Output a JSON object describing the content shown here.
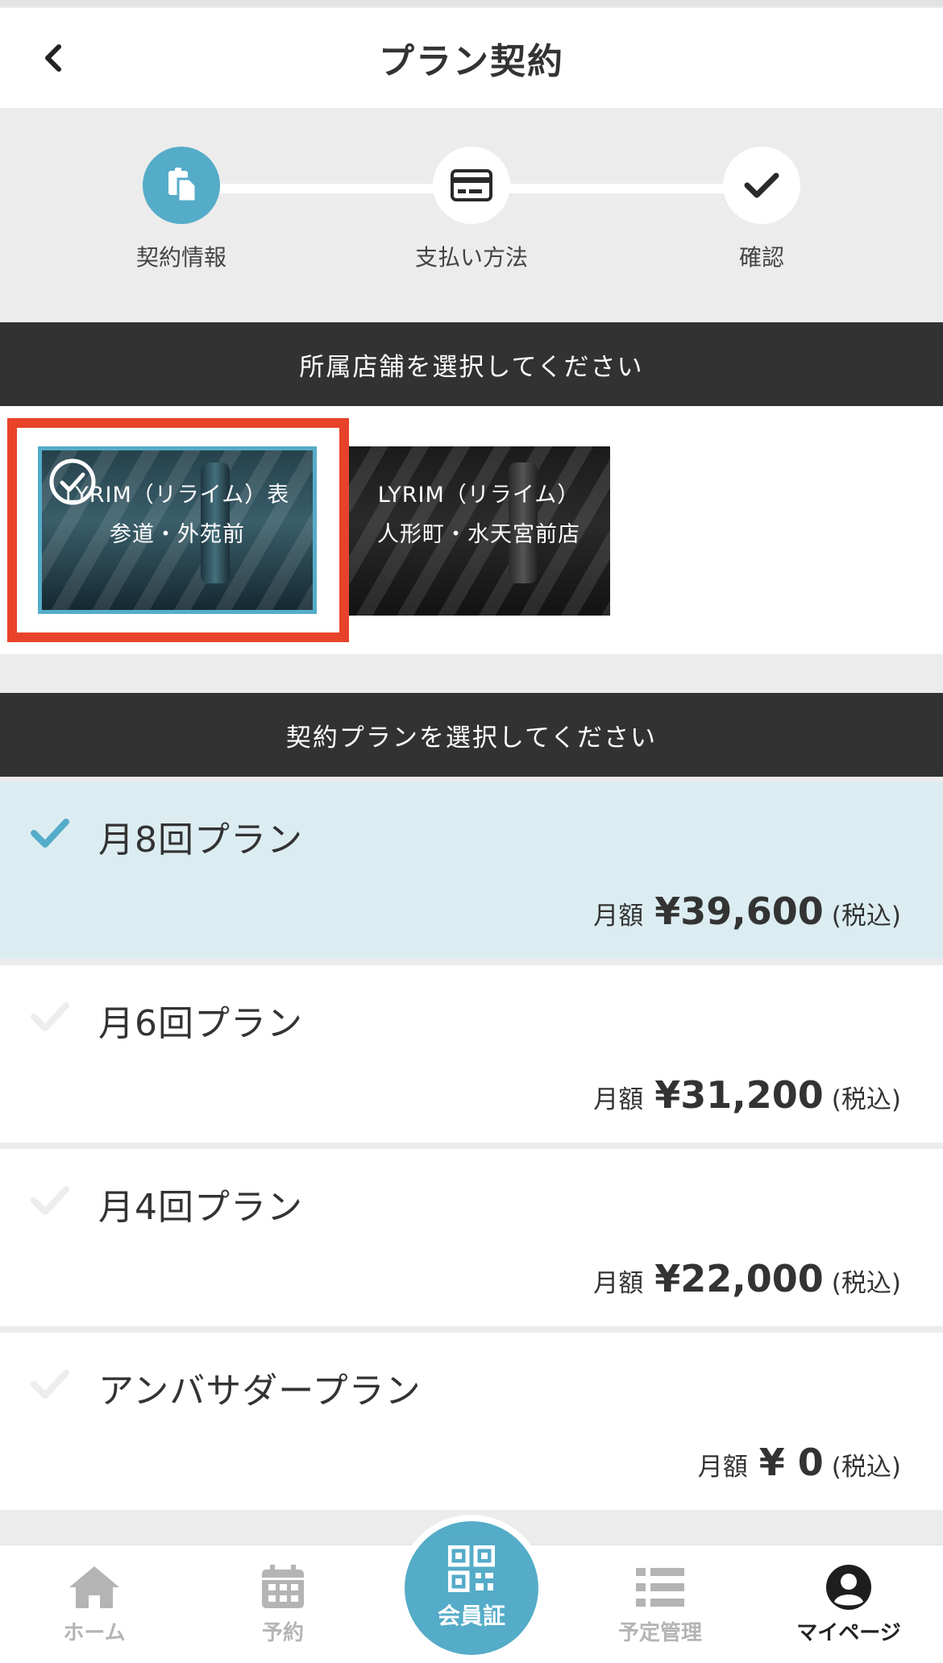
{
  "header": {
    "title": "プラン契約"
  },
  "stepper": {
    "steps": [
      {
        "label": "契約情報",
        "icon": "clipboard-icon",
        "active": true
      },
      {
        "label": "支払い方法",
        "icon": "credit-card-icon",
        "active": false
      },
      {
        "label": "確認",
        "icon": "checkmark-icon",
        "active": false
      }
    ]
  },
  "store_section": {
    "title": "所属店舗を選択してください",
    "stores": [
      {
        "name": "LYRIM（リライム）表参道・外苑前",
        "selected": true
      },
      {
        "name": "LYRIM（リライム）人形町・水天宮前店",
        "selected": false
      }
    ]
  },
  "plan_section": {
    "title": "契約プランを選択してください",
    "plans": [
      {
        "name": "月8回プラン",
        "price_prefix": "月額",
        "price": "¥39,600",
        "tax": "(税込)",
        "selected": true
      },
      {
        "name": "月6回プラン",
        "price_prefix": "月額",
        "price": "¥31,200",
        "tax": "(税込)",
        "selected": false
      },
      {
        "name": "月4回プラン",
        "price_prefix": "月額",
        "price": "¥22,000",
        "tax": "(税込)",
        "selected": false
      },
      {
        "name": "アンバサダープラン",
        "price_prefix": "月額",
        "price": "¥ 0",
        "tax": "(税込)",
        "selected": false
      }
    ]
  },
  "bottom_nav": {
    "home": "ホーム",
    "reserve": "予約",
    "member_card": "会員証",
    "schedule": "予定管理",
    "mypage": "マイページ",
    "active": "mypage"
  },
  "colors": {
    "accent": "#55acc8",
    "selected_row": "#dcedf2",
    "section_bar": "#323232",
    "highlight_box": "#e8432a"
  }
}
